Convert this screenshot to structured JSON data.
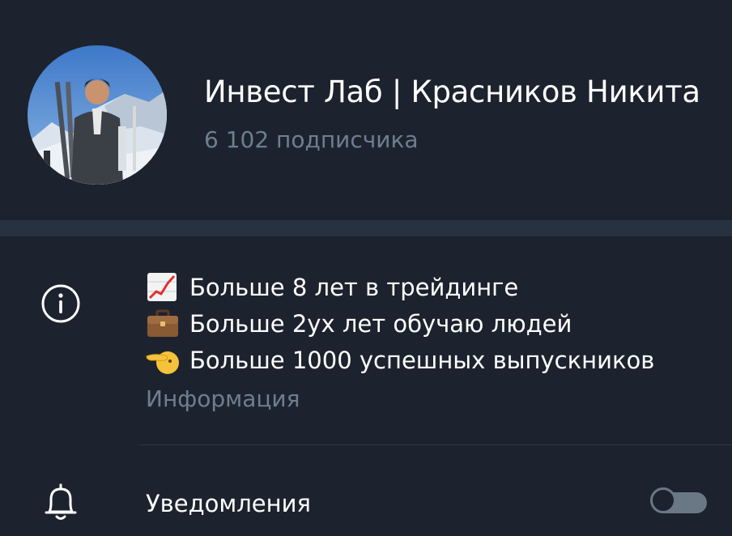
{
  "channel": {
    "name": "Инвест Лаб | Красников Никита",
    "subscribers": "6 102 подписчика",
    "avatar": "avatar-photo"
  },
  "info": {
    "icon": "info-icon",
    "lines": [
      {
        "emoji": "chart-increasing-emoji",
        "text": "Больше 8 лет в трейдинге"
      },
      {
        "emoji": "briefcase-emoji",
        "text": "Больше 2ух лет обучаю людей"
      },
      {
        "emoji": "pointing-hand-emoji",
        "text": "Больше 1000 успешных выпускников"
      }
    ],
    "caption": "Информация"
  },
  "notifications": {
    "icon": "bell-icon",
    "label": "Уведомления",
    "enabled": false
  },
  "colors": {
    "background": "#1d232e",
    "band": "#273241",
    "secondary_text": "#6d7f8f",
    "toggle_off": "#6a7785"
  }
}
